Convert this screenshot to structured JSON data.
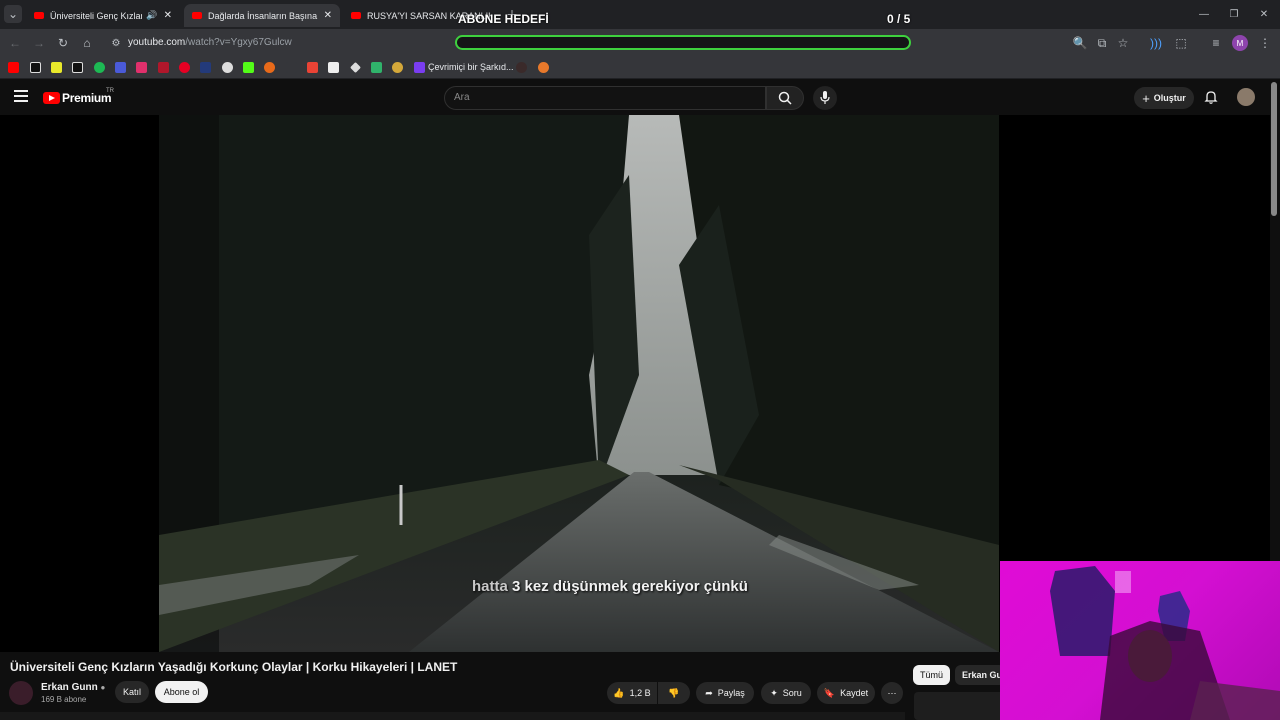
{
  "browser": {
    "tabs": [
      {
        "title": "Üniversiteli Genç Kızların Ya",
        "audio": true,
        "active": false
      },
      {
        "title": "Dağlarda İnsanların Başına Gele",
        "active": true
      },
      {
        "title": "RUSYA'YI SARSAN KARANLIK",
        "active": false
      }
    ],
    "url_host": "youtube.com",
    "url_path": "/watch?v=Ygxy67Gulcw",
    "bookmark_label": "Çevrimiçi bir Şarkıd...",
    "profile_initial": "M"
  },
  "overlay": {
    "goal_label": "ABONE HEDEFİ",
    "goal_count": "0 / 5",
    "goal_progress": 0
  },
  "youtube": {
    "brand": "Premium",
    "brand_region": "TR",
    "search_placeholder": "Ara",
    "create_label": "Oluştur"
  },
  "video": {
    "caption_words": [
      "hatta",
      "3 kez düşünmek gerekiyor çünkü"
    ],
    "title": "Üniversiteli Genç Kızların Yaşadığı Korkunç Olaylar | Korku Hikayeleri | LANET",
    "channel": "Erkan Gunn",
    "subscribers": "169 B abone",
    "join_label": "Katıl",
    "subscribe_label": "Abone ol",
    "likes": "1,2 B",
    "share_label": "Paylaş",
    "ask_label": "Soru",
    "save_label": "Kaydet"
  },
  "sidebar": {
    "filters": [
      "Tümü",
      "Erkan Gunn"
    ]
  },
  "colors": {
    "goal_green": "#3ed13e",
    "webcam_magenta": "#e00bd6",
    "yt_red": "#ff0000"
  }
}
